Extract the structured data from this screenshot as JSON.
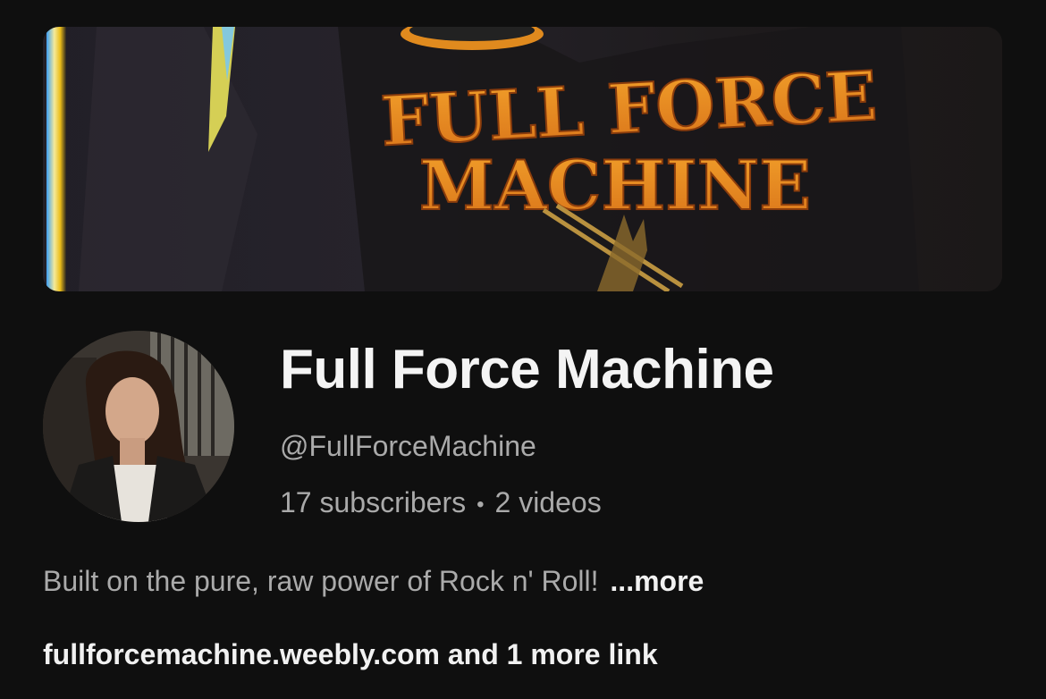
{
  "banner": {
    "artwork_text_line1": "FULL FORCE",
    "artwork_text_line2": "MACHINE"
  },
  "channel": {
    "name": "Full Force Machine",
    "handle": "@FullForceMachine",
    "subscribers": "17 subscribers",
    "separator": "•",
    "videos": "2 videos",
    "description": "Built on the pure, raw power of Rock n' Roll!",
    "more_label": "...more",
    "link_primary": "fullforcemachine.weebly.com",
    "link_more": "and 1 more link"
  },
  "colors": {
    "background": "#0f0f0f",
    "primary_text": "#f1f1f1",
    "secondary_text": "#aaaaaa",
    "banner_logo": "#e8891c"
  }
}
